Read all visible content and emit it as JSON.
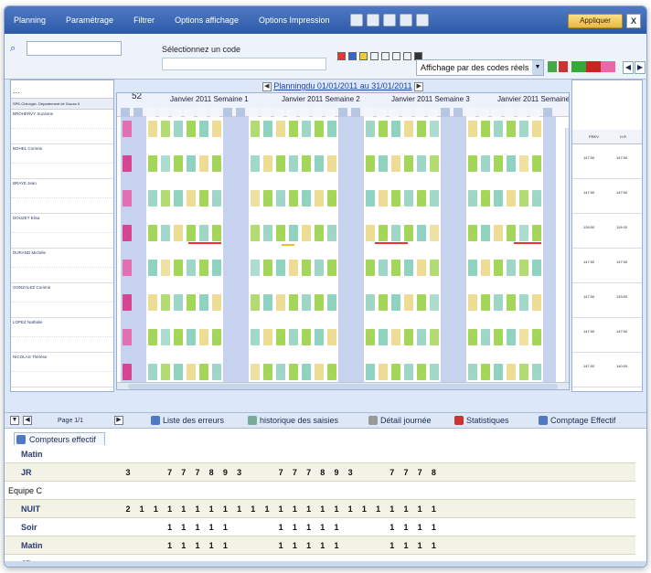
{
  "menu": [
    "Planning",
    "Paramétrage",
    "Filtrer",
    "Options affichage",
    "Options Impression"
  ],
  "apply_label": "Appliquer",
  "close_label": "X",
  "select_code_label": "Sélectionnez un code",
  "display_select": "Affichage par des codes réels",
  "plan_title": "Planningdu 01/01/2011 au 31/01/2011",
  "week_num": "52",
  "weeks": [
    "Janvier 2011 Semaine 1",
    "Janvier 2011 Semaine 2",
    "Janvier 2011 Semaine 3",
    "Janvier 2011 Semaine"
  ],
  "left_header": "...",
  "left_col_label": "SPE-Chirurgie- Département de Gouza II",
  "employees": [
    "BROHERVY Suzanne",
    "BOHEL Corinne",
    "BRAYE Jean",
    "DOUZET Elisa",
    "DURAND Michèle",
    "GONZALEZ Corinne",
    "LOPEZ Nathalie",
    "NICOLAS Thérèse"
  ],
  "right_headers": [
    "PREV",
    "H R"
  ],
  "right_rows": [
    [
      "147:00",
      "147:00"
    ],
    [
      "147:00",
      "147:00"
    ],
    [
      "126:00",
      "119:00"
    ],
    [
      "147:00",
      "147:00"
    ],
    [
      "147:00",
      "133:00"
    ],
    [
      "147:00",
      "147:00"
    ],
    [
      "147:00",
      "140:00"
    ],
    [
      "119:00",
      "112:00"
    ]
  ],
  "page_label": "Page 1/1",
  "bottom_tabs": [
    "Liste des erreurs",
    "historique des saisies",
    "Détail journée",
    "Statistiques",
    "Comptage Effectif"
  ],
  "counter_tab": "Compteurs effectif",
  "counter_rows": [
    {
      "label": "Matin",
      "group": false,
      "values": [
        "",
        "",
        "",
        "",
        "",
        "",
        "",
        "",
        "",
        "",
        "",
        "",
        "",
        "",
        "",
        "",
        "",
        "",
        "",
        "",
        "",
        "",
        ""
      ]
    },
    {
      "label": "JR",
      "group": false,
      "values": [
        "3",
        "",
        "",
        "7",
        "7",
        "7",
        "8",
        "9",
        "3",
        "",
        "",
        "7",
        "7",
        "7",
        "8",
        "9",
        "3",
        "",
        "",
        "7",
        "7",
        "7",
        "8"
      ]
    },
    {
      "label": "Equipe C",
      "group": true,
      "values": []
    },
    {
      "label": "NUIT",
      "group": false,
      "values": [
        "2",
        "1",
        "1",
        "1",
        "1",
        "1",
        "1",
        "1",
        "1",
        "1",
        "1",
        "1",
        "1",
        "1",
        "1",
        "1",
        "1",
        "1",
        "1",
        "1",
        "1",
        "1",
        "1"
      ]
    },
    {
      "label": "Soir",
      "group": false,
      "values": [
        "",
        "",
        "",
        "1",
        "1",
        "1",
        "1",
        "1",
        "",
        "",
        "",
        "1",
        "1",
        "1",
        "1",
        "1",
        "",
        "",
        "",
        "1",
        "1",
        "1",
        "1"
      ]
    },
    {
      "label": "Matin",
      "group": false,
      "values": [
        "",
        "",
        "",
        "1",
        "1",
        "1",
        "1",
        "1",
        "",
        "",
        "",
        "1",
        "1",
        "1",
        "1",
        "1",
        "",
        "",
        "",
        "1",
        "1",
        "1",
        "1"
      ]
    },
    {
      "label": "JR",
      "group": false,
      "values": [
        "",
        "",
        "",
        "",
        "",
        "",
        "",
        "",
        "",
        "",
        "",
        "",
        "",
        "",
        "",
        "",
        "",
        "",
        "",
        "",
        "",
        "",
        ""
      ]
    }
  ]
}
